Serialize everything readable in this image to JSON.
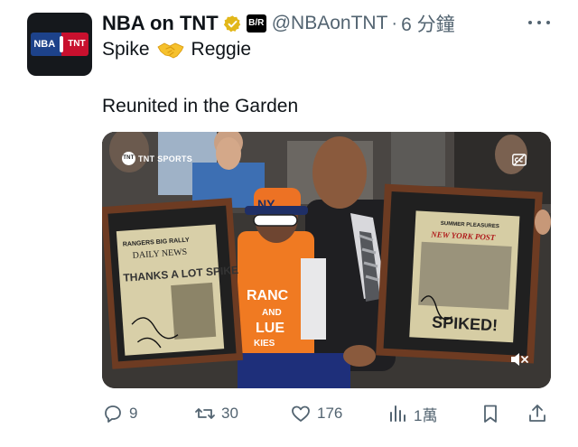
{
  "tweet": {
    "display_name": "NBA on TNT",
    "affiliate_badge": "B/R",
    "handle": "@NBAonTNT",
    "separator": "·",
    "time": "6 分鐘",
    "avatar": {
      "left": "NBA",
      "right": "TNT"
    },
    "text_line1_left": "Spike",
    "text_line1_emoji": "handshake-emoji",
    "text_line1_right": "Reggie",
    "text_line2": "Reunited in the Garden"
  },
  "media": {
    "broadcaster": "TNT SPORTS",
    "broadcaster_badge": "TNT",
    "icons": [
      "closed-captions-icon",
      "mute-icon"
    ],
    "left_frame": {
      "banner": "RANGERS BIG RALLY",
      "paper": "DAILY NEWS",
      "headline": "THANKS A LOT SPIKE"
    },
    "right_frame": {
      "banner": "SUMMER PLEASURES",
      "paper": "NEW YORK POST",
      "headline": "SPIKED!"
    },
    "cap_text": "NY",
    "shirt_text_1": "RANC",
    "shirt_text_2": "AND",
    "shirt_text_3": "LUE",
    "shirt_text_4": "KIES"
  },
  "actions": {
    "replies": "9",
    "retweets": "30",
    "likes": "176",
    "views": "1萬"
  },
  "colors": {
    "text": "#0f1419",
    "secondary": "#536471",
    "verified_gold": "#e2b719",
    "nba_blue": "#1d428a",
    "tnt_red": "#c8102e",
    "knicks_orange": "#f58426"
  }
}
